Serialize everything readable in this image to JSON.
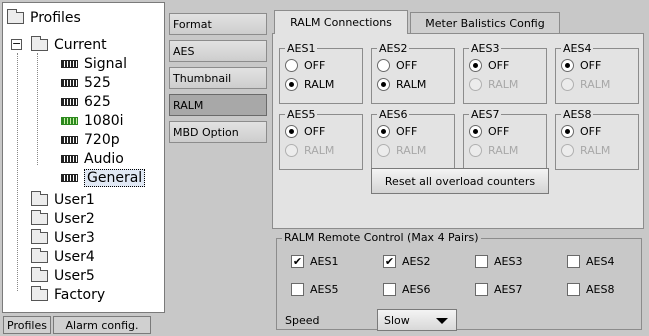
{
  "tree": {
    "root": "Profiles",
    "current": "Current",
    "current_children": [
      "Signal",
      "525",
      "625",
      "1080i",
      "720p",
      "Audio",
      "General"
    ],
    "users": [
      "User1",
      "User2",
      "User3",
      "User4",
      "User5"
    ],
    "factory": "Factory"
  },
  "bottom_tabs": {
    "profiles": "Profiles",
    "alarm": "Alarm config."
  },
  "menu": [
    "Format",
    "AES",
    "Thumbnail",
    "RALM",
    "MBD Option"
  ],
  "tabs": {
    "ralm": "RALM Connections",
    "meter": "Meter Balistics Config"
  },
  "groups": [
    {
      "title": "AES1",
      "off": "OFF",
      "ralm": "RALM"
    },
    {
      "title": "AES2",
      "off": "OFF",
      "ralm": "RALM"
    },
    {
      "title": "AES3",
      "off": "OFF",
      "ralm": "RALM"
    },
    {
      "title": "AES4",
      "off": "OFF",
      "ralm": "RALM"
    },
    {
      "title": "AES5",
      "off": "OFF",
      "ralm": "RALM"
    },
    {
      "title": "AES6",
      "off": "OFF",
      "ralm": "RALM"
    },
    {
      "title": "AES7",
      "off": "OFF",
      "ralm": "RALM"
    },
    {
      "title": "AES8",
      "off": "OFF",
      "ralm": "RALM"
    }
  ],
  "reset_button": "Reset all overload counters",
  "remote": {
    "title": "RALM Remote Control (Max 4 Pairs)",
    "checks": [
      "AES1",
      "AES2",
      "AES3",
      "AES4",
      "AES5",
      "AES6",
      "AES7",
      "AES8"
    ],
    "speed_label": "Speed",
    "speed_value": "Slow"
  }
}
